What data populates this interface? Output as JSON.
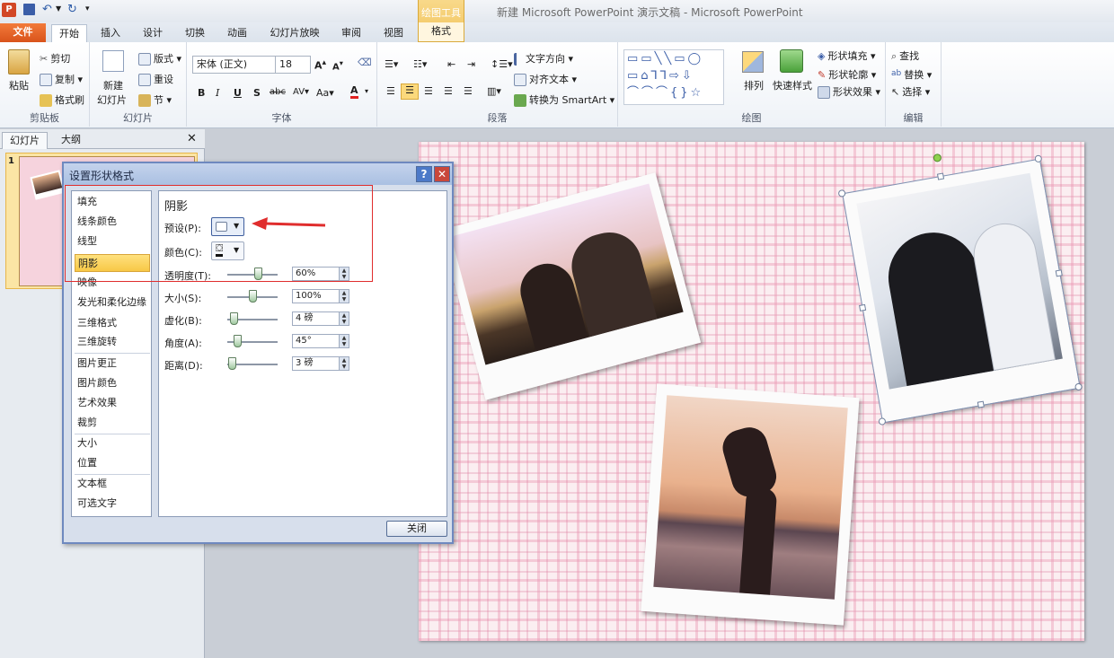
{
  "title_bar": {
    "title": "新建 Microsoft PowerPoint 演示文稿 - Microsoft PowerPoint",
    "context_tools": "绘图工具",
    "context_tab": "格式"
  },
  "tabs": [
    "文件",
    "开始",
    "插入",
    "设计",
    "切换",
    "动画",
    "幻灯片放映",
    "审阅",
    "视图"
  ],
  "ribbon": {
    "clipboard": {
      "label": "剪贴板",
      "paste": "粘贴",
      "cut": "剪切",
      "copy": "复制",
      "format_painter": "格式刷"
    },
    "slides": {
      "label": "幻灯片",
      "new_slide_1": "新建",
      "new_slide_2": "幻灯片",
      "layout": "版式",
      "reset": "重设",
      "section": "节"
    },
    "font": {
      "label": "字体",
      "font_name": "宋体 (正文)",
      "font_size": "18"
    },
    "paragraph": {
      "label": "段落",
      "text_direction": "文字方向",
      "align_text": "对齐文本",
      "smartart": "转换为 SmartArt"
    },
    "drawing": {
      "label": "绘图",
      "arrange": "排列",
      "quick_styles": "快速样式",
      "shape_fill": "形状填充",
      "shape_outline": "形状轮廓",
      "shape_effects": "形状效果"
    },
    "editing": {
      "label": "编辑",
      "find": "查找",
      "replace": "替换",
      "select": "选择"
    }
  },
  "left_panel": {
    "tab_slides": "幻灯片",
    "tab_outline": "大纲",
    "slide_number": "1"
  },
  "dialog": {
    "title": "设置形状格式",
    "categories": [
      "填充",
      "线条颜色",
      "线型",
      "阴影",
      "映像",
      "发光和柔化边缘",
      "三维格式",
      "三维旋转",
      "图片更正",
      "图片颜色",
      "艺术效果",
      "裁剪",
      "大小",
      "位置",
      "文本框",
      "可选文字"
    ],
    "selected_category": "阴影",
    "section_title": "阴影",
    "preset_label": "预设(P):",
    "color_label": "颜色(C):",
    "transparency_label": "透明度(T):",
    "size_label": "大小(S):",
    "blur_label": "虚化(B):",
    "angle_label": "角度(A):",
    "distance_label": "距离(D):",
    "transparency_value": "60%",
    "size_value": "100%",
    "blur_value": "4 磅",
    "angle_value": "45°",
    "distance_value": "3 磅",
    "close_button": "关闭"
  },
  "colors": {
    "file_tab": "#e5682a",
    "annotation": "#e02d2d",
    "selected_category": "#f7c846"
  }
}
